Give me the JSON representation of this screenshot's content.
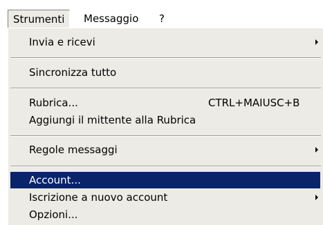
{
  "menubar": {
    "items": [
      {
        "label": "Strumenti"
      },
      {
        "label": "Messaggio"
      },
      {
        "label": "?"
      }
    ]
  },
  "menu": {
    "items": [
      {
        "label": "Invia e ricevi",
        "submenu": true
      },
      {
        "label": "Sincronizza tutto"
      },
      {
        "label": "Rubrica...",
        "shortcut": "CTRL+MAIUSC+B"
      },
      {
        "label": "Aggiungi il mittente alla Rubrica"
      },
      {
        "label": "Regole messaggi",
        "submenu": true
      },
      {
        "label": "Account...",
        "highlighted": true
      },
      {
        "label": "Iscrizione a nuovo account",
        "submenu": true
      },
      {
        "label": "Opzioni..."
      }
    ]
  },
  "colors": {
    "menu_background": "#ecebe6",
    "highlight": "#0a246a",
    "highlight_text": "#ffffff"
  }
}
